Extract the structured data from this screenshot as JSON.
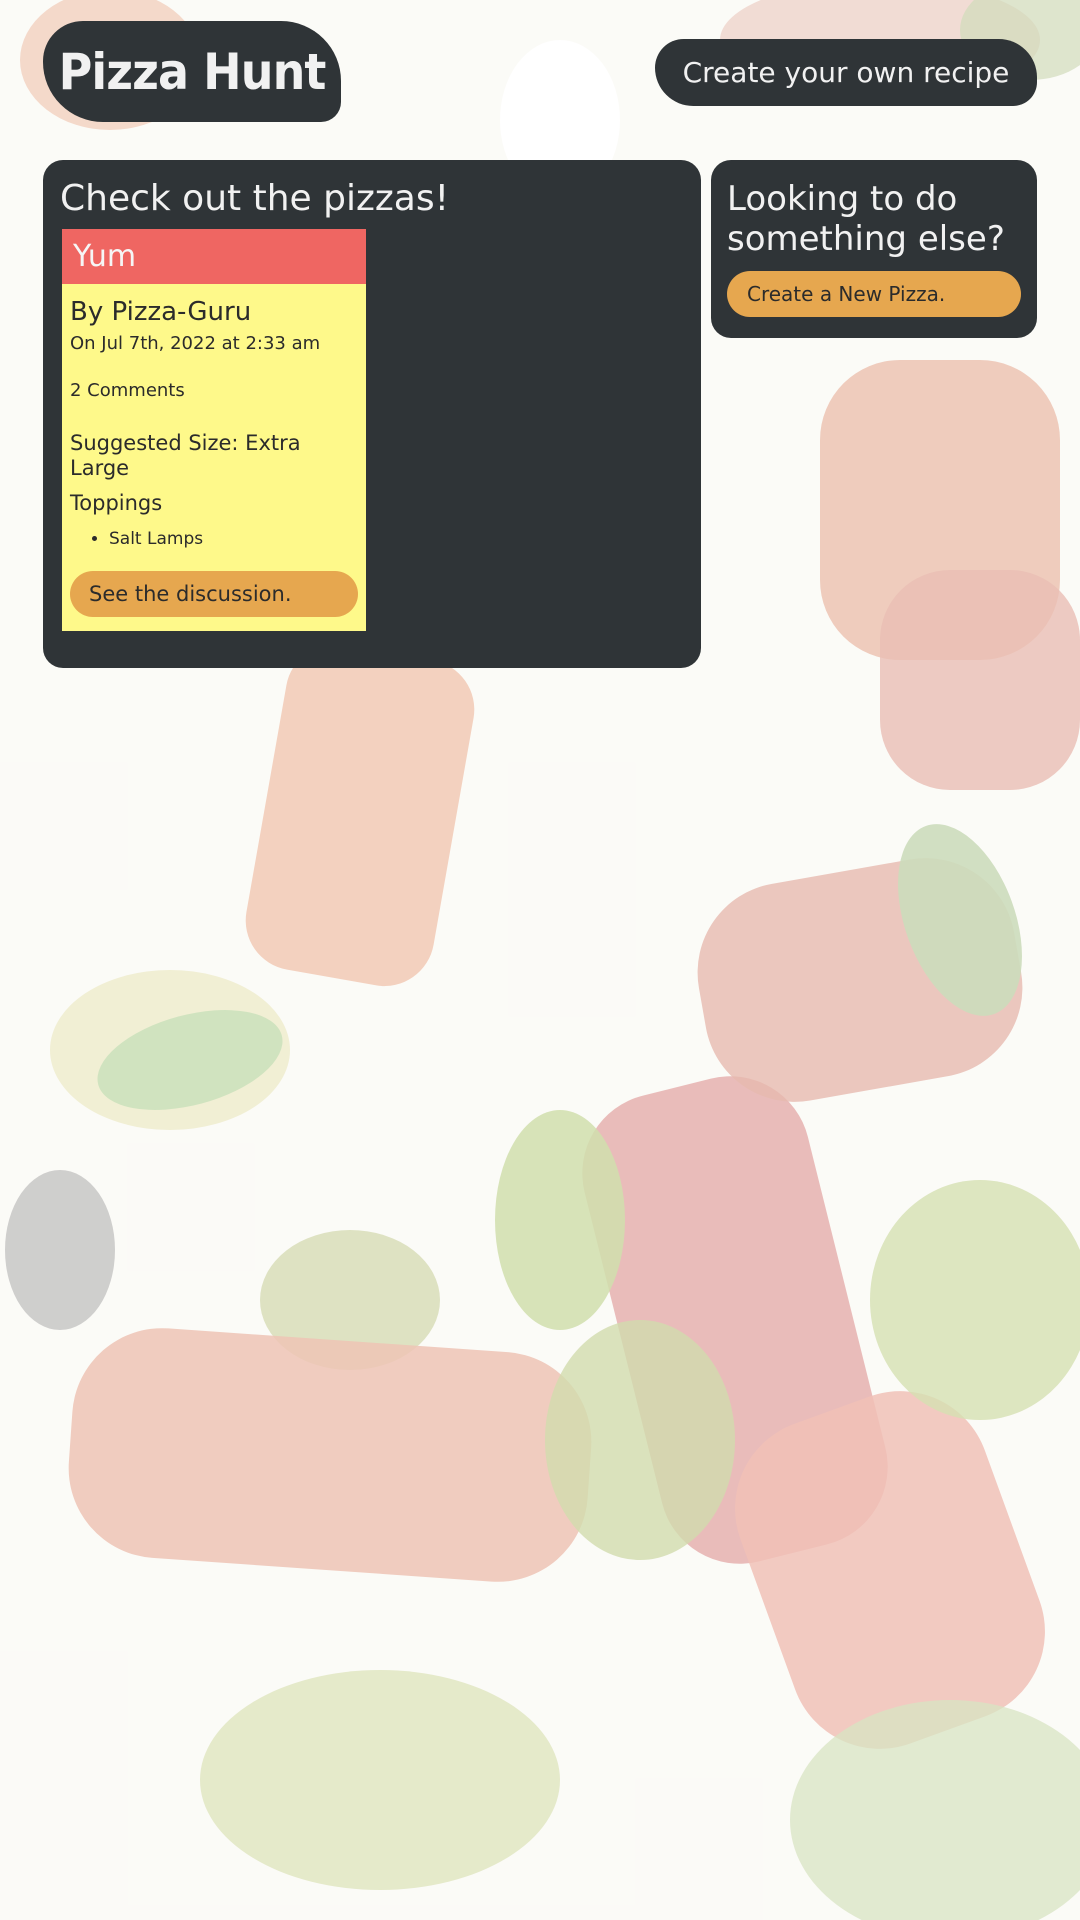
{
  "header": {
    "brand": "Pizza Hunt",
    "create_recipe_label": "Create your own recipe"
  },
  "main": {
    "title": "Check out the pizzas!",
    "pizzas": [
      {
        "name": "Yum",
        "by": "By Pizza-Guru",
        "date": "On Jul 7th, 2022 at 2:33 am",
        "comments": "2 Comments",
        "size": "Suggested Size: Extra Large",
        "toppings_heading": "Toppings",
        "toppings": [
          "Salt Lamps"
        ],
        "discussion_label": "See the discussion."
      }
    ]
  },
  "sidebar": {
    "title": "Looking to do something else?",
    "new_pizza_label": "Create a New Pizza."
  },
  "colors": {
    "panel": "#2f3437",
    "card_header": "#ef6662",
    "card_body": "#fef98a",
    "button": "#e6a74f",
    "text_light": "#f1f1f1"
  }
}
